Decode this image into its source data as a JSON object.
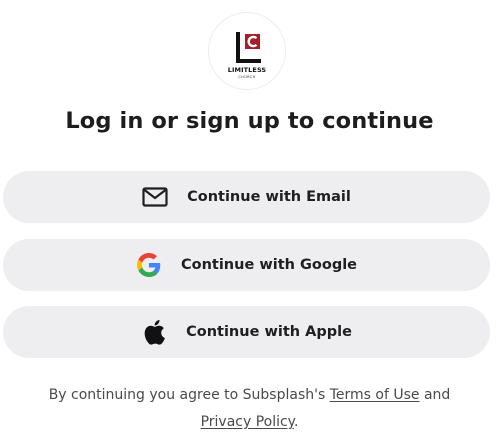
{
  "logo": {
    "name": "LIMITLESS",
    "sub": "CHURCH",
    "letter": "C",
    "accent_color": "#a51f2a"
  },
  "heading": "Log in or sign up to continue",
  "buttons": {
    "email": {
      "label": "Continue with Email",
      "icon": "mail-icon"
    },
    "google": {
      "label": "Continue with Google",
      "icon": "google-icon"
    },
    "apple": {
      "label": "Continue with Apple",
      "icon": "apple-icon"
    }
  },
  "legal": {
    "prefix": "By continuing you agree to Subsplash's ",
    "terms": "Terms of Use",
    "and": " and",
    "privacy": "Privacy Policy",
    "suffix": "."
  },
  "colors": {
    "button_bg": "#eeeef0",
    "text": "#1d1d1d",
    "muted": "#4a4a4a"
  }
}
